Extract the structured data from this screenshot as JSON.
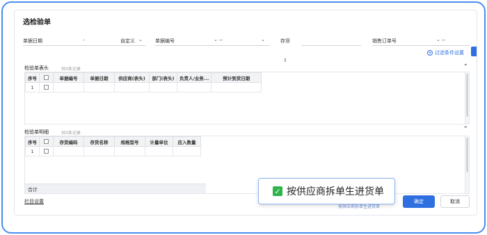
{
  "title": "选检验单",
  "filters": [
    {
      "label": "单据日期",
      "value": "-",
      "extra": "自定义"
    },
    {
      "label": "单据编号",
      "value": "--"
    },
    {
      "label": "存货",
      "value": ""
    },
    {
      "label": "销售订单号",
      "value": "--"
    }
  ],
  "filter_settings": "过滤条件设置",
  "drag_glyph": "⇕",
  "head_section": {
    "name": "检验单表头",
    "count": "共0条记录",
    "columns": [
      "序号",
      "",
      "单据编号",
      "单据日期",
      "供应商(表头)",
      "部门(表头)",
      "负责人/业务...",
      "预计到货日期"
    ],
    "rows": [
      {
        "seq": "1"
      }
    ]
  },
  "detail_section": {
    "name": "检验单明细",
    "count": "共0条记录",
    "columns": [
      "序号",
      "",
      "存货编码",
      "存货名称",
      "规格型号",
      "计量单位",
      "应入数量"
    ],
    "rows": [
      {
        "seq": "1"
      }
    ],
    "total_label": "合计"
  },
  "footer": {
    "settings_link": "栏目设置",
    "ok_label": "确定",
    "cancel_label": "取消",
    "under_tooltip": "按供应商拆单生进货单"
  },
  "tooltip": {
    "text": "按供应商拆单生进货单",
    "checked": true
  },
  "colors": {
    "accent": "#2f6fe0",
    "frame": "#4a8cf0",
    "check": "#2fb34b"
  }
}
